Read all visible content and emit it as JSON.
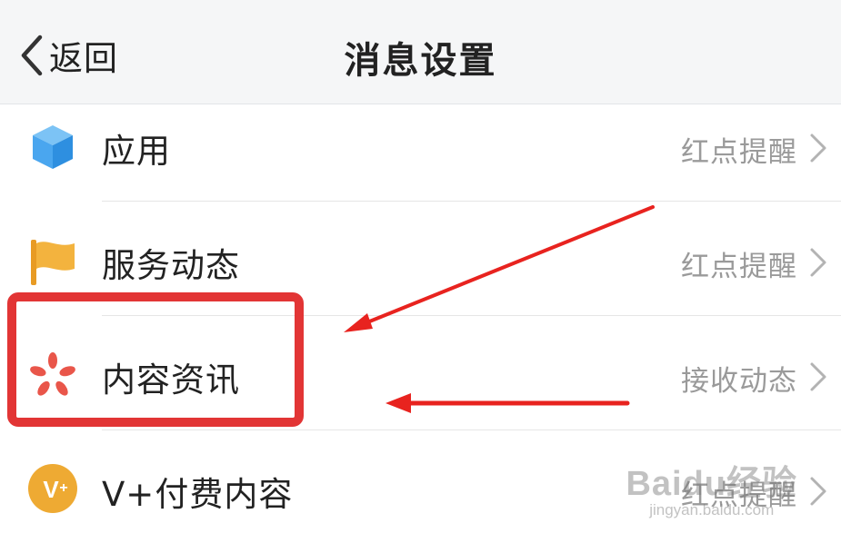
{
  "navbar": {
    "back_label": "返回",
    "title": "消息设置"
  },
  "rows": [
    {
      "label": "应用",
      "value": "红点提醒",
      "icon": "cube-icon"
    },
    {
      "label": "服务动态",
      "value": "红点提醒",
      "icon": "flag-icon"
    },
    {
      "label": "内容资讯",
      "value": "接收动态",
      "icon": "flower-icon"
    },
    {
      "label": "V+付费内容",
      "value": "红点提醒",
      "icon": "vplus-icon"
    }
  ],
  "watermark": {
    "brand": "Baidu经验",
    "url": "jingyan.baidu.com"
  },
  "colors": {
    "highlight": "#e23535",
    "cube": "#4aa6ef",
    "flag": "#f3b33e",
    "flower": "#e9564a",
    "vplus": "#eeaa33"
  }
}
